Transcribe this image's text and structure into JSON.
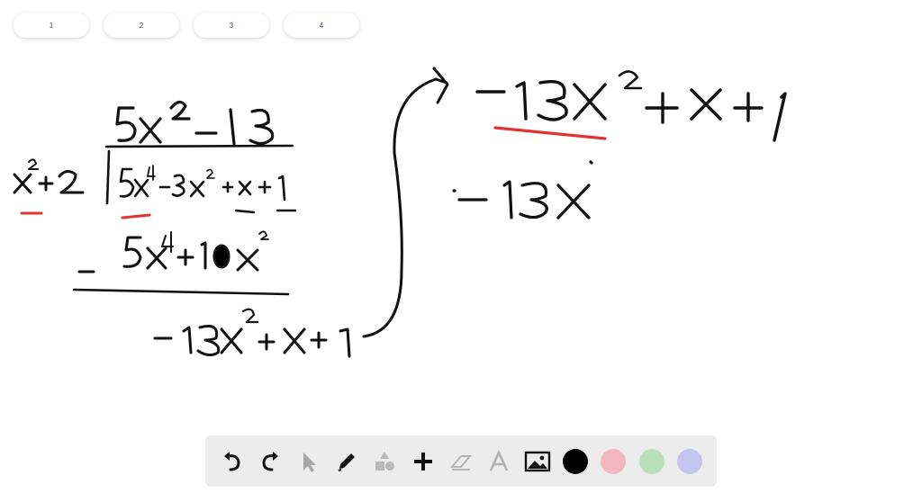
{
  "pages": {
    "tabs": [
      {
        "label": "1"
      },
      {
        "label": "2"
      },
      {
        "label": "3"
      },
      {
        "label": "4"
      }
    ]
  },
  "toolbar": {
    "tools": [
      {
        "name": "undo-icon",
        "enabled": true
      },
      {
        "name": "redo-icon",
        "enabled": true
      },
      {
        "name": "pointer-icon",
        "enabled": false
      },
      {
        "name": "pen-icon",
        "enabled": true
      },
      {
        "name": "shapes-icon",
        "enabled": false
      },
      {
        "name": "plus-icon",
        "enabled": true
      },
      {
        "name": "eraser-icon",
        "enabled": false
      },
      {
        "name": "text-icon",
        "enabled": false
      },
      {
        "name": "image-icon",
        "enabled": true
      }
    ],
    "colors": [
      "#000000",
      "#f2b8c0",
      "#b8e0b8",
      "#c4c4f0"
    ],
    "selected_color": "#000000"
  },
  "annotation_color": "#e03434"
}
